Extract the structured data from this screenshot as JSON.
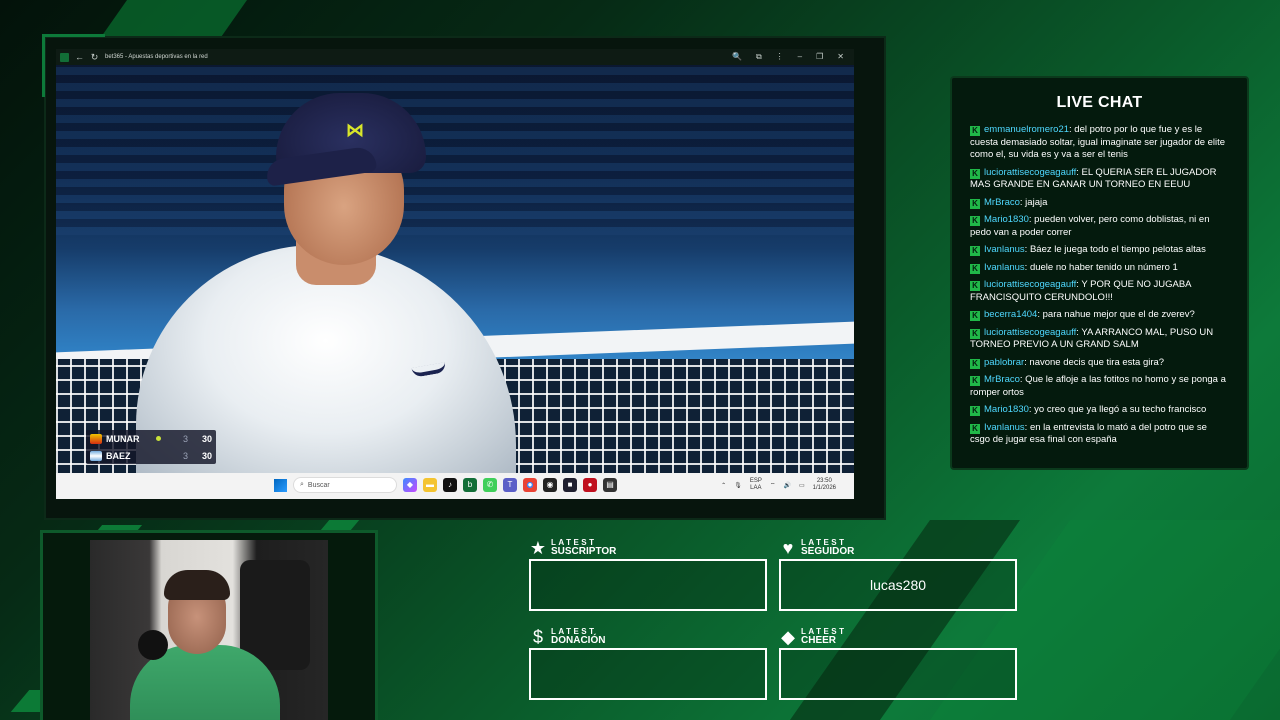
{
  "browser": {
    "title": "bet365 - Apuestas deportivas en la red"
  },
  "scoreboard": {
    "players": [
      {
        "name": "MUNAR",
        "sets": "3",
        "points": "30",
        "serving": true
      },
      {
        "name": "BAEZ",
        "sets": "3",
        "points": "30",
        "serving": false
      }
    ]
  },
  "taskbar": {
    "search_placeholder": "Buscar",
    "lang": "ESP",
    "lang_sub": "LAA",
    "time": "23:50",
    "date": "1/1/2026"
  },
  "chat": {
    "title": "LIVE CHAT",
    "messages": [
      {
        "user": "emmanuelromero21",
        "text": ": del potro por lo que fue y es le cuesta demasiado soltar, igual imaginate ser jugador de elite como el, su vida es y va a ser el tenis"
      },
      {
        "user": "luciorattisecogeagauff",
        "text": ": EL QUERIA SER EL JUGADOR MAS GRANDE EN GANAR UN TORNEO EN EEUU"
      },
      {
        "user": "MrBraco",
        "text": ": jajaja"
      },
      {
        "user": "Mario1830",
        "text": ": pueden volver, pero como doblistas, ni en pedo van a poder correr"
      },
      {
        "user": "Ivanlanus",
        "text": ": Báez le juega todo el tiempo pelotas altas"
      },
      {
        "user": "Ivanlanus",
        "text": ": duele no haber tenido un número 1"
      },
      {
        "user": "luciorattisecogeagauff",
        "text": ": Y POR QUE NO JUGABA FRANCISQUITO CERUNDOLO!!!"
      },
      {
        "user": "becerra1404",
        "text": ": para nahue mejor que el de zverev?"
      },
      {
        "user": "luciorattisecogeagauff",
        "text": ": YA ARRANCO MAL, PUSO UN TORNEO PREVIO A UN GRAND SALM"
      },
      {
        "user": "pablobrar",
        "text": ": navone decis que tira esta gira?"
      },
      {
        "user": "MrBraco",
        "text": ": Que le afloje a las fotitos no homo y se ponga a romper ortos"
      },
      {
        "user": "Mario1830",
        "text": ": yo creo que ya llegó a su techo francisco"
      },
      {
        "user": "Ivanlanus",
        "text": ": en la entrevista lo mató a del potro que se csgo de jugar esa final con españa"
      }
    ]
  },
  "latest": {
    "suscriptor": {
      "small": "LATEST",
      "label": "SUSCRIPTOR",
      "value": ""
    },
    "seguidor": {
      "small": "LATEST",
      "label": "SEGUIDOR",
      "value": "lucas280"
    },
    "donacion": {
      "small": "LATEST",
      "label": "DONACIÓN",
      "value": ""
    },
    "cheer": {
      "small": "LATEST",
      "label": "CHEER",
      "value": ""
    }
  },
  "colors": {
    "accent": "#0d7a3a",
    "chat_user": "#4fd8ff",
    "badge": "#20b848"
  }
}
